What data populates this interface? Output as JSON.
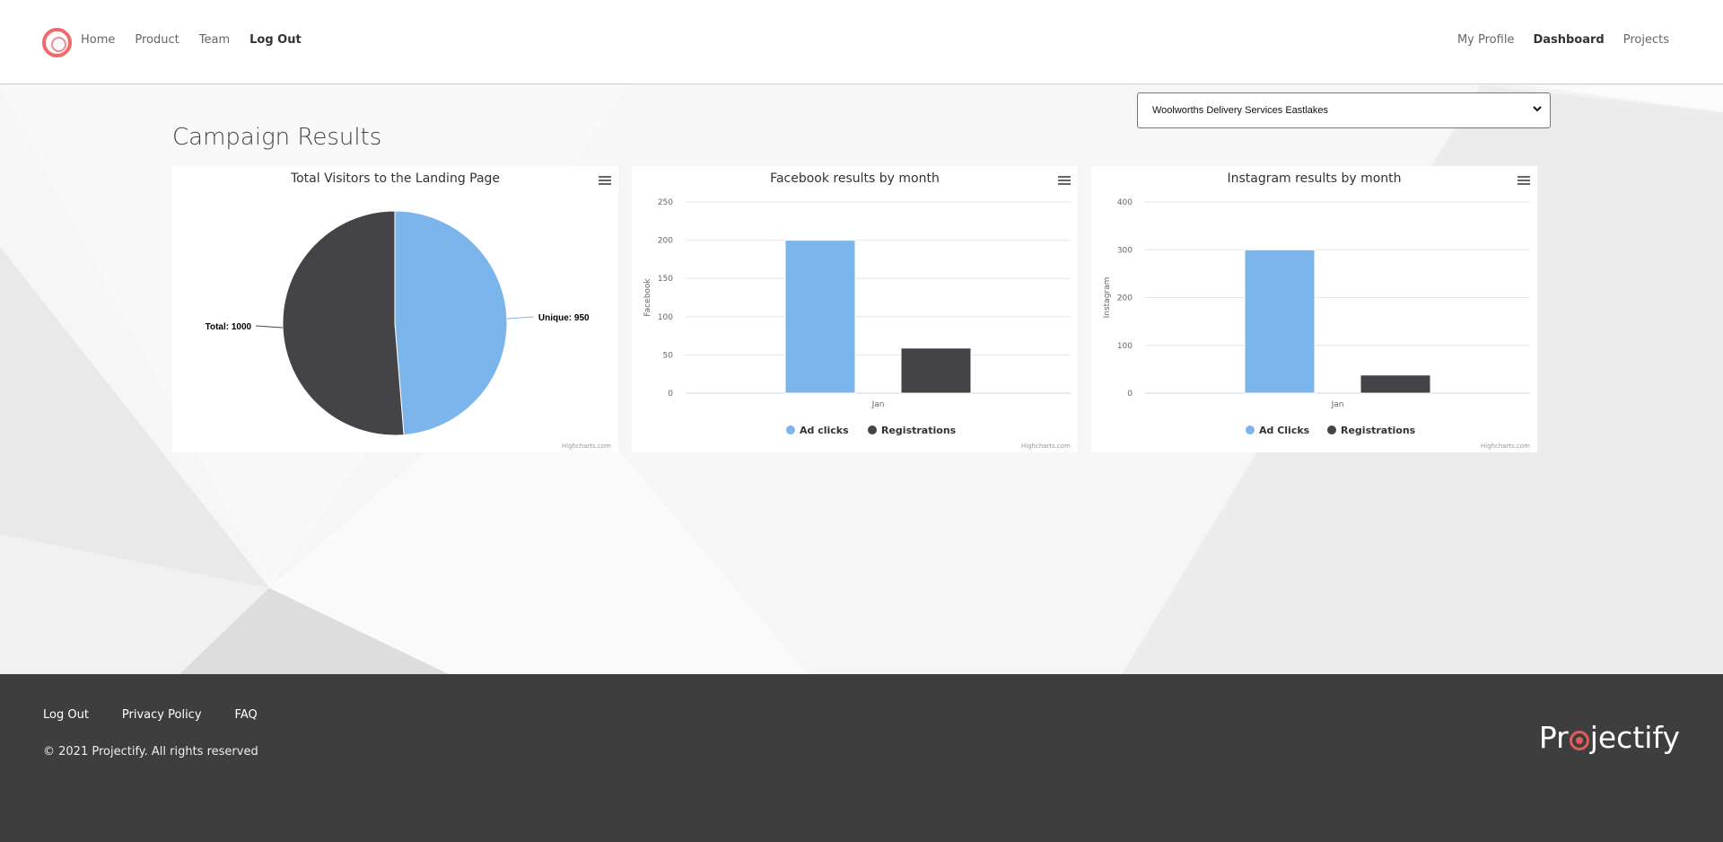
{
  "header": {
    "nav_left": [
      "Home",
      "Product",
      "Team",
      "Log Out"
    ],
    "nav_right": [
      "My Profile",
      "Dashboard",
      "Projects"
    ]
  },
  "select": {
    "value": "Woolworths Delivery Services Eastlakes"
  },
  "page_title": "Campaign Results",
  "credits": "Highcharts.com",
  "colors": {
    "blue": "#7cb5ec",
    "dark": "#434348",
    "accent": "#ee6b6b",
    "footer": "#3e3e3e"
  },
  "chart_data": [
    {
      "type": "pie",
      "title": "Total Visitors to the Landing Page",
      "slices": [
        {
          "name": "Unique",
          "value": 950,
          "label": "Unique: 950",
          "color": "#7cb5ec"
        },
        {
          "name": "Total",
          "value": 1000,
          "label": "Total: 1000",
          "color": "#434348"
        }
      ]
    },
    {
      "type": "bar",
      "title": "Facebook results by month",
      "ylabel": "Facebook",
      "xlabel": "",
      "categories": [
        "Jan"
      ],
      "ylim": [
        0,
        250
      ],
      "yticks": [
        0,
        50,
        100,
        150,
        200,
        250
      ],
      "series": [
        {
          "name": "Ad clicks",
          "values": [
            200
          ],
          "color": "#7cb5ec"
        },
        {
          "name": "Registrations",
          "values": [
            59
          ],
          "color": "#434348"
        }
      ],
      "legend": "bottom"
    },
    {
      "type": "bar",
      "title": "Instagram results by month",
      "ylabel": "Instagram",
      "xlabel": "",
      "categories": [
        "Jan"
      ],
      "ylim": [
        0,
        400
      ],
      "yticks": [
        0,
        100,
        200,
        300,
        400
      ],
      "series": [
        {
          "name": "Ad Clicks",
          "values": [
            300
          ],
          "color": "#7cb5ec"
        },
        {
          "name": "Registrations",
          "values": [
            38
          ],
          "color": "#434348"
        }
      ],
      "legend": "bottom"
    }
  ],
  "footer": {
    "links": [
      "Log Out",
      "Privacy Policy",
      "FAQ"
    ],
    "copyright": "© 2021 Projectify. All rights reserved",
    "brand_pre": "Pr",
    "brand_post": "jectify"
  }
}
